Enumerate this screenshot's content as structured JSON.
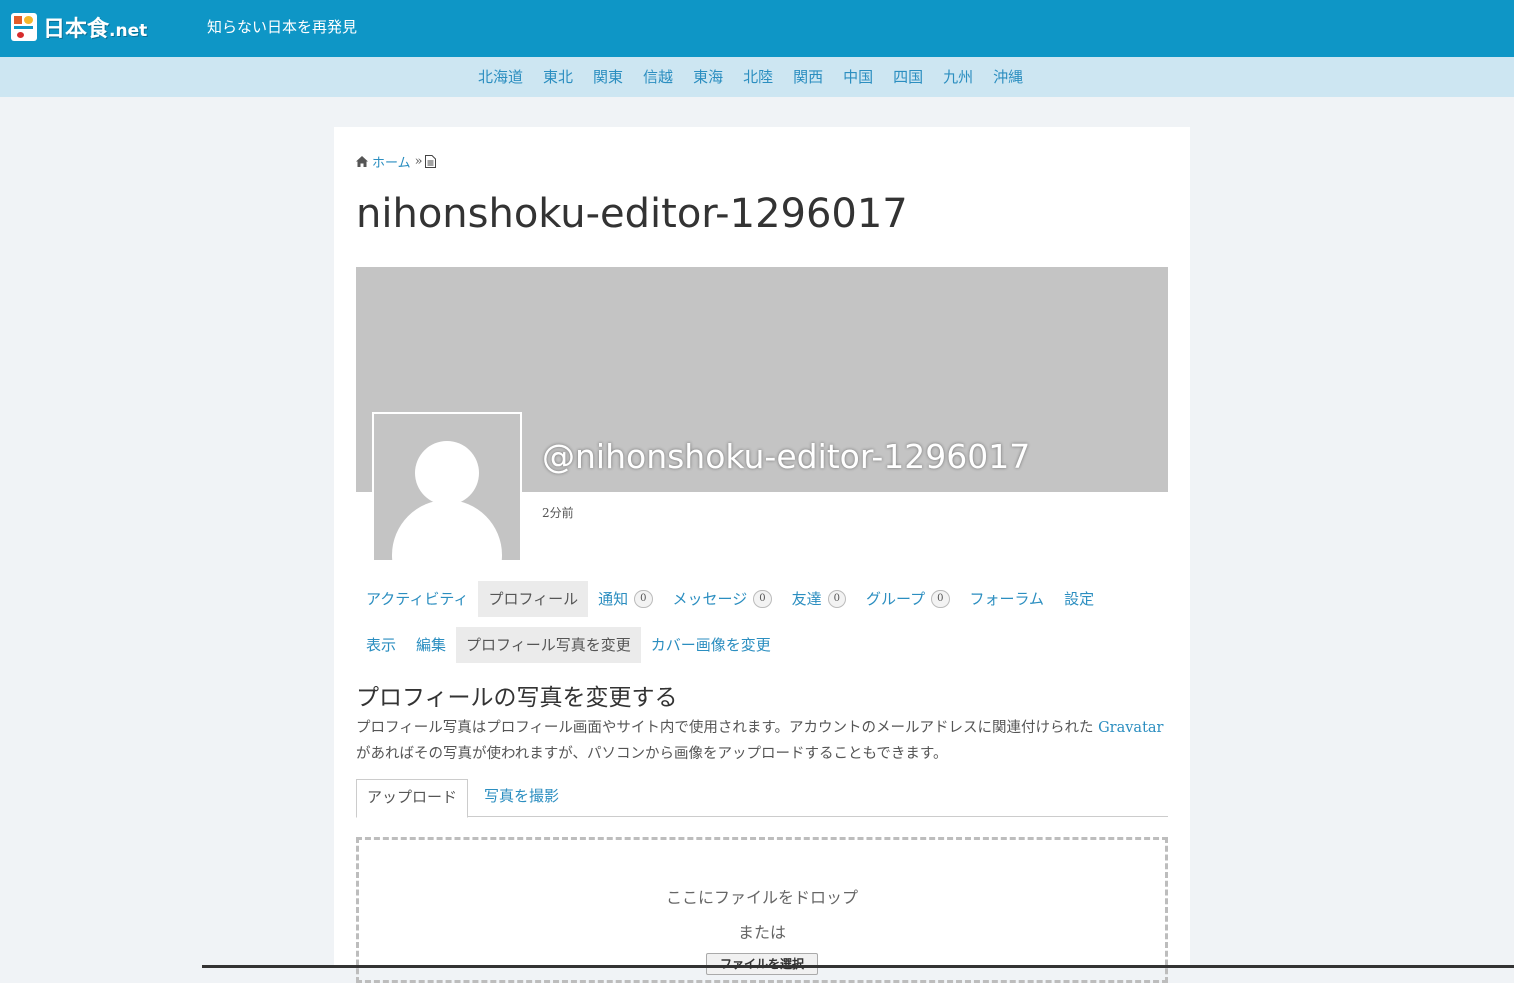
{
  "header": {
    "logo_text": "日本食",
    "logo_suffix": ".net",
    "tagline": "知らない日本を再発見"
  },
  "regions": [
    "北海道",
    "東北",
    "関東",
    "信越",
    "東海",
    "北陸",
    "関西",
    "中国",
    "四国",
    "九州",
    "沖縄"
  ],
  "breadcrumb": {
    "home": "ホーム",
    "separator": "»"
  },
  "page_title": "nihonshoku-editor-1296017",
  "profile": {
    "handle": "@nihonshoku-editor-1296017",
    "last_active": "2分前"
  },
  "nav_primary": [
    {
      "label": "アクティビティ"
    },
    {
      "label": "プロフィール",
      "current": true
    },
    {
      "label": "通知",
      "count": "0"
    },
    {
      "label": "メッセージ",
      "count": "0"
    },
    {
      "label": "友達",
      "count": "0"
    },
    {
      "label": "グループ",
      "count": "0"
    },
    {
      "label": "フォーラム"
    },
    {
      "label": "設定"
    }
  ],
  "nav_secondary": [
    {
      "label": "表示"
    },
    {
      "label": "編集"
    },
    {
      "label": "プロフィール写真を変更",
      "current": true
    },
    {
      "label": "カバー画像を変更"
    }
  ],
  "section": {
    "title": "プロフィールの写真を変更する",
    "desc_part1": "プロフィール写真はプロフィール画面やサイト内で使用されます。アカウントのメールアドレスに関連付けられた ",
    "desc_link": "Gravatar",
    "desc_part2": " があればその写真が使われますが、パソコンから画像をアップロードすることもできます。"
  },
  "tabs": {
    "upload": "アップロード",
    "camera": "写真を撮影"
  },
  "dropzone": {
    "drop_text": "ここにファイルをドロップ",
    "or_text": "または",
    "button_label": "ファイルを選択"
  },
  "colors": {
    "header_bg": "#0e96c6",
    "region_bg": "#cde6f2",
    "link": "#2b8ec0",
    "cover": "#c4c4c4"
  }
}
